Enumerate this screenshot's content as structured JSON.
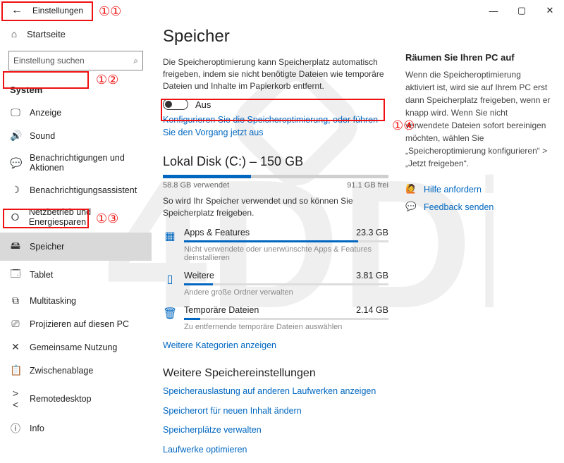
{
  "titlebar": {
    "back_aria": "Zurück",
    "app_title": "Einstellungen"
  },
  "sidebar": {
    "home": "Startseite",
    "search_placeholder": "Einstellung suchen",
    "category": "System",
    "items": [
      {
        "icon": "display-icon",
        "glyph": "🖵",
        "label": "Anzeige"
      },
      {
        "icon": "sound-icon",
        "glyph": "🔊",
        "label": "Sound"
      },
      {
        "icon": "notifications-icon",
        "glyph": "💬",
        "label": "Benachrichtigungen und Aktionen"
      },
      {
        "icon": "focus-assist-icon",
        "glyph": "☽",
        "label": "Benachrichtigungsassistent"
      },
      {
        "icon": "power-icon",
        "glyph": "🞆",
        "label": "Netzbetrieb und Energiesparen"
      },
      {
        "icon": "storage-icon",
        "glyph": "🖴",
        "label": "Speicher",
        "selected": true
      },
      {
        "icon": "tablet-icon",
        "glyph": "🗔",
        "label": "Tablet"
      },
      {
        "icon": "multitasking-icon",
        "glyph": "⧉",
        "label": "Multitasking"
      },
      {
        "icon": "project-icon",
        "glyph": "⎚",
        "label": "Projizieren auf diesen PC"
      },
      {
        "icon": "shared-icon",
        "glyph": "✕",
        "label": "Gemeinsame Nutzung"
      },
      {
        "icon": "clipboard-icon",
        "glyph": "📋",
        "label": "Zwischenablage"
      },
      {
        "icon": "remote-icon",
        "glyph": "><",
        "label": "Remotedesktop"
      },
      {
        "icon": "info-icon",
        "glyph": "ⓘ",
        "label": "Info"
      }
    ]
  },
  "main": {
    "page_title": "Speicher",
    "description": "Die Speicheroptimierung kann Speicherplatz automatisch freigeben, indem sie nicht benötigte Dateien wie temporäre Dateien und Inhalte im Papierkorb entfernt.",
    "toggle_state": "Aus",
    "configure_link": "Konfigurieren Sie die Speicheroptimierung, oder führen Sie den Vorgang jetzt aus",
    "disk": {
      "title": "Lokal Disk (C:) – 150 GB",
      "used_pct": 39,
      "used_label": "58.8 GB verwendet",
      "free_label": "91.1 GB frei",
      "sub": "So wird Ihr Speicher verwendet und so können Sie Speicherplatz freigeben."
    },
    "categories": [
      {
        "icon": "apps-icon",
        "glyph": "▦",
        "name": "Apps & Features",
        "size": "23.3 GB",
        "pct": 85,
        "sub": "Nicht verwendete oder unerwünschte Apps & Features deinstallieren"
      },
      {
        "icon": "other-icon",
        "glyph": "▯",
        "name": "Weitere",
        "size": "3.81 GB",
        "pct": 14,
        "sub": "Andere große Ordner verwalten"
      },
      {
        "icon": "temp-icon",
        "glyph": "🗑",
        "name": "Temporäre Dateien",
        "size": "2.14 GB",
        "pct": 8,
        "sub": "Zu entfernende temporäre Dateien auswählen"
      }
    ],
    "more_categories": "Weitere Kategorien anzeigen",
    "more_settings_title": "Weitere Speichereinstellungen",
    "more_links": [
      "Speicherauslastung auf anderen Laufwerken anzeigen",
      "Speicherort für neuen Inhalt ändern",
      "Speicherplätze verwalten",
      "Laufwerke optimieren"
    ]
  },
  "aside": {
    "title": "Räumen Sie Ihren PC auf",
    "body": "Wenn die Speicheroptimierung aktiviert ist, wird sie auf Ihrem PC erst dann Speicherplatz freigeben, wenn er knapp wird. Wenn Sie nicht verwendete Dateien sofort bereinigen möchten, wählen Sie „Speicheroptimierung konfigurieren“ > „Jetzt freigeben“.",
    "help": "Hilfe anfordern",
    "feedback": "Feedback senden"
  },
  "annotations": {
    "n1": "①",
    "n2": "②",
    "n3": "③",
    "n4": "④"
  }
}
